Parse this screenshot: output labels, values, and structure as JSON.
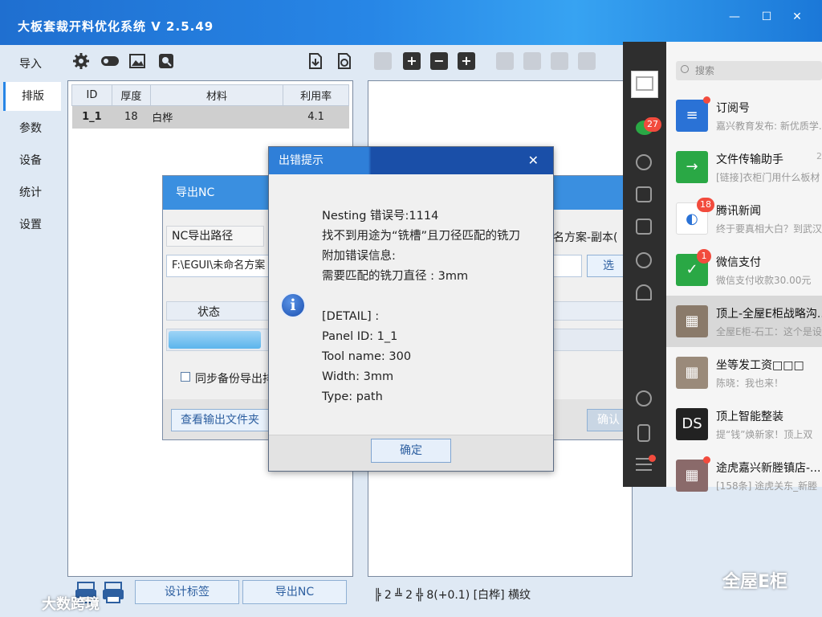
{
  "app": {
    "title": "大板套裁开料优化系统  V 2.5.49",
    "window_controls": [
      "—",
      "☐",
      "✕"
    ]
  },
  "sidebar": {
    "items": [
      {
        "label": "导入"
      },
      {
        "label": "排版",
        "active": true
      },
      {
        "label": "参数"
      },
      {
        "label": "设备"
      },
      {
        "label": "统计"
      },
      {
        "label": "设置"
      }
    ]
  },
  "toolbar": {
    "plus": "+",
    "minus": "−",
    "plus_box": "+"
  },
  "table": {
    "headers": [
      "ID",
      "厚度",
      "材料",
      "利用率"
    ],
    "rows": [
      {
        "id": "1_1",
        "thickness": "18",
        "material": "白桦",
        "rate": "4.1"
      }
    ]
  },
  "bottom_buttons": {
    "label": "设计标签",
    "export": "导出NC"
  },
  "status_line": "╠ 2 ╩ 2  ╬ 8(+0.1)  [白桦]  横纹",
  "nc_dialog": {
    "title": "导出NC",
    "path_label": "NC导出路径",
    "path_value": "F:\\EGUI\\未命名方案",
    "right_value": "名方案-副本(",
    "browse_button": "选",
    "status_header": "状态",
    "progress": 0.2,
    "checkbox_label": "同步备份导出排",
    "open_folder_button": "查看输出文件夹",
    "confirm_button": "确认"
  },
  "error_dialog": {
    "title": "出错提示",
    "close": "✕",
    "info_icon": "i",
    "lines": [
      "Nesting 错误号:1114",
      "找不到用途为“铣槽”且刀径匹配的铣刀",
      "附加错误信息:",
      "需要匹配的铣刀直径 : 3mm",
      "",
      "[DETAIL] :",
      "Panel ID:  1_1",
      "Tool name:  300",
      "Width:  3mm",
      "Type:  path"
    ],
    "ok_button": "确定"
  },
  "wechat": {
    "search_placeholder": "搜索",
    "nav_badge": "27",
    "chats": [
      {
        "name": "订阅号",
        "preview": "嘉兴教育发布: 新优质学...",
        "time": "",
        "badge": "",
        "dot": true,
        "avatar_color": "#2a72d6",
        "avatar_text": "≡"
      },
      {
        "name": "文件传输助手",
        "preview": "[链接]衣柜门用什么板材",
        "time": "2",
        "badge": "",
        "dot": false,
        "avatar_color": "#2aa845",
        "avatar_text": "→"
      },
      {
        "name": "腾讯新闻",
        "preview": "终于要真相大白？到武汉",
        "time": "",
        "badge": "18",
        "dot": false,
        "avatar_color": "#ffffff",
        "avatar_text": "◐"
      },
      {
        "name": "微信支付",
        "preview": "微信支付收款30.00元",
        "time": "",
        "badge": "1",
        "dot": false,
        "avatar_color": "#2aa845",
        "avatar_text": "✓"
      },
      {
        "name": "顶上-全屋E柜战略沟...",
        "preview": "全屋E柜-石工：这个是设",
        "time": "",
        "badge": "",
        "dot": false,
        "avatar_color": "#8a7a6a",
        "avatar_text": "▦",
        "selected": true
      },
      {
        "name": "坐等发工资□□□",
        "preview": "陈晓：我也来！",
        "time": "",
        "badge": "",
        "dot": false,
        "avatar_color": "#9a8a7a",
        "avatar_text": "▦"
      },
      {
        "name": "顶上智能整装",
        "preview": "提“钱”焕新家！顶上双",
        "time": "",
        "badge": "",
        "dot": false,
        "avatar_color": "#222222",
        "avatar_text": "DS"
      },
      {
        "name": "途虎嘉兴新塍镇店-...",
        "preview": "[158条] 途虎关东_新塍",
        "time": "",
        "badge": "",
        "dot": true,
        "avatar_color": "#8a6a6a",
        "avatar_text": "▦"
      }
    ]
  },
  "watermarks": {
    "right": "全屋E柜",
    "left": "大数跨境"
  }
}
